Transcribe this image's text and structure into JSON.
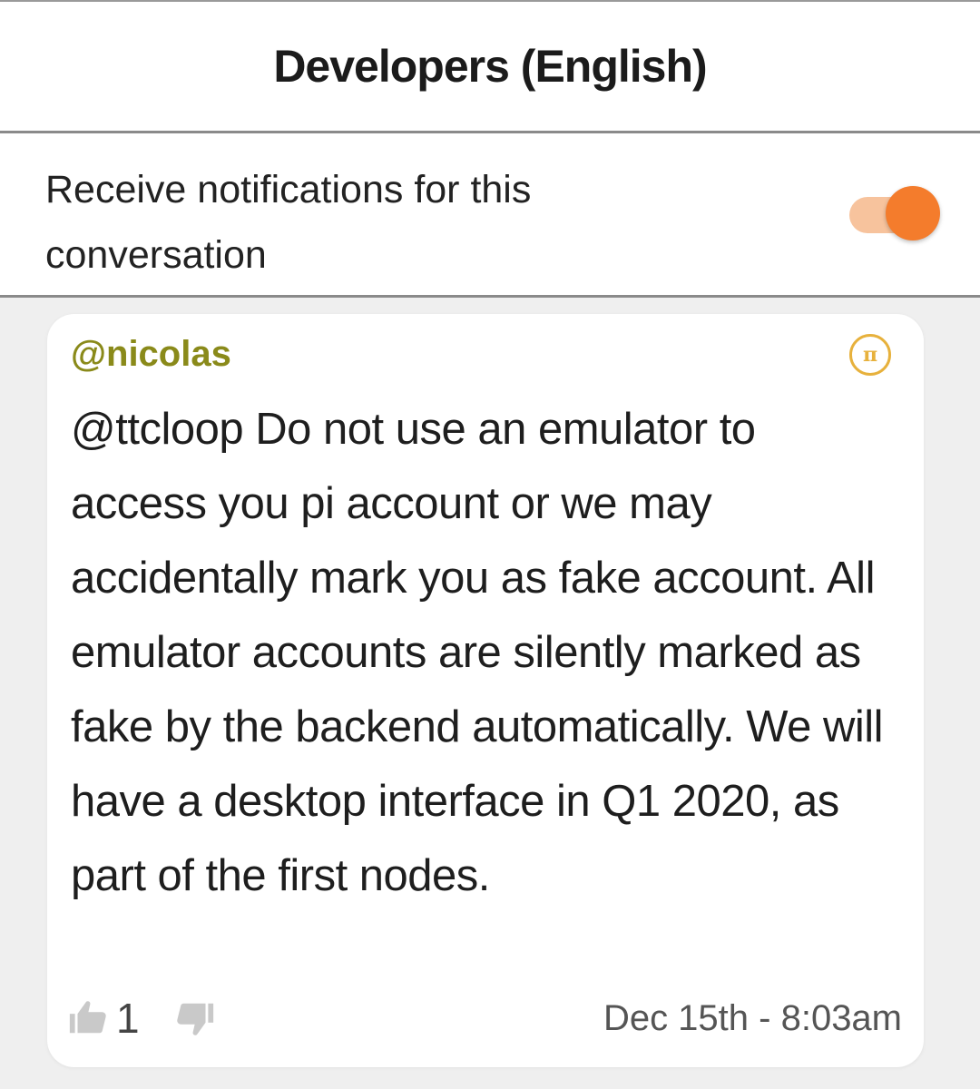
{
  "header": {
    "title": "Developers (English)"
  },
  "notifications": {
    "label": "Receive notifications for this conversation",
    "enabled": true,
    "toggle_color": "#f47c2c"
  },
  "comment": {
    "author": "@nicolas",
    "author_color": "#8a8a1a",
    "badge_icon": "pi-coin-icon",
    "badge_text": "π",
    "text": "@ttcloop Do not use an emulator to access you pi account or we may accidentally mark you as fake account. All emulator accounts are silently marked as fake by the backend automatically. We will have a desktop interface in Q1 2020, as part of the first nodes.",
    "likes": "1",
    "like_icon": "thumbs-up-icon",
    "dislike_icon": "thumbs-down-icon",
    "timestamp": "Dec 15th - 8:03am"
  }
}
